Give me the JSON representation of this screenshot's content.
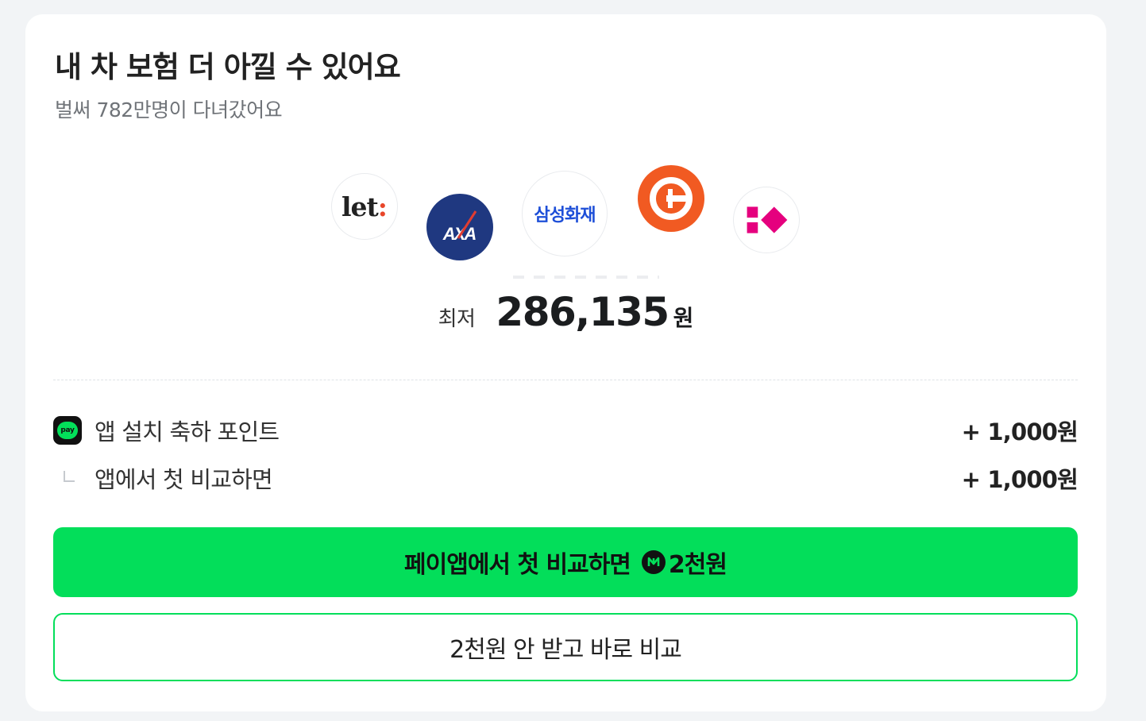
{
  "card": {
    "title": "내 차 보험 더 아낄 수 있어요",
    "subtitle": "벌써 782만명이 다녀갔어요"
  },
  "insurers": [
    {
      "name": "let:",
      "icon": "let-logo-icon",
      "color": "#e8462a"
    },
    {
      "name": "AXA",
      "icon": "axa-logo-icon",
      "color": "#1f3880"
    },
    {
      "name": "삼성화재",
      "icon": "samsung-fire-logo-icon",
      "color": "#1e4fd8"
    },
    {
      "name": "Hanwha",
      "icon": "hanwha-logo-icon",
      "color": "#f15a22"
    },
    {
      "name": "Carrot",
      "icon": "carrot-logo-icon",
      "color": "#e5007e"
    }
  ],
  "price": {
    "prefix": "최저",
    "amount": "286,135",
    "unit": "원"
  },
  "rewards": [
    {
      "label": "앱 설치 축하 포인트",
      "value": "+ 1,000원",
      "icon": "pay-badge-icon"
    },
    {
      "label": "앱에서 첫 비교하면",
      "value": "+ 1,000원",
      "icon": "sub-item-icon"
    }
  ],
  "pay_badge_text": "pay",
  "buttons": {
    "primary_label": "페이앱에서 첫 비교하면",
    "primary_reward": "2천원",
    "secondary_label": "2천원 안 받고 바로 비교"
  },
  "colors": {
    "accent": "#03de5a",
    "background": "#f2f4f6",
    "card": "#ffffff"
  }
}
